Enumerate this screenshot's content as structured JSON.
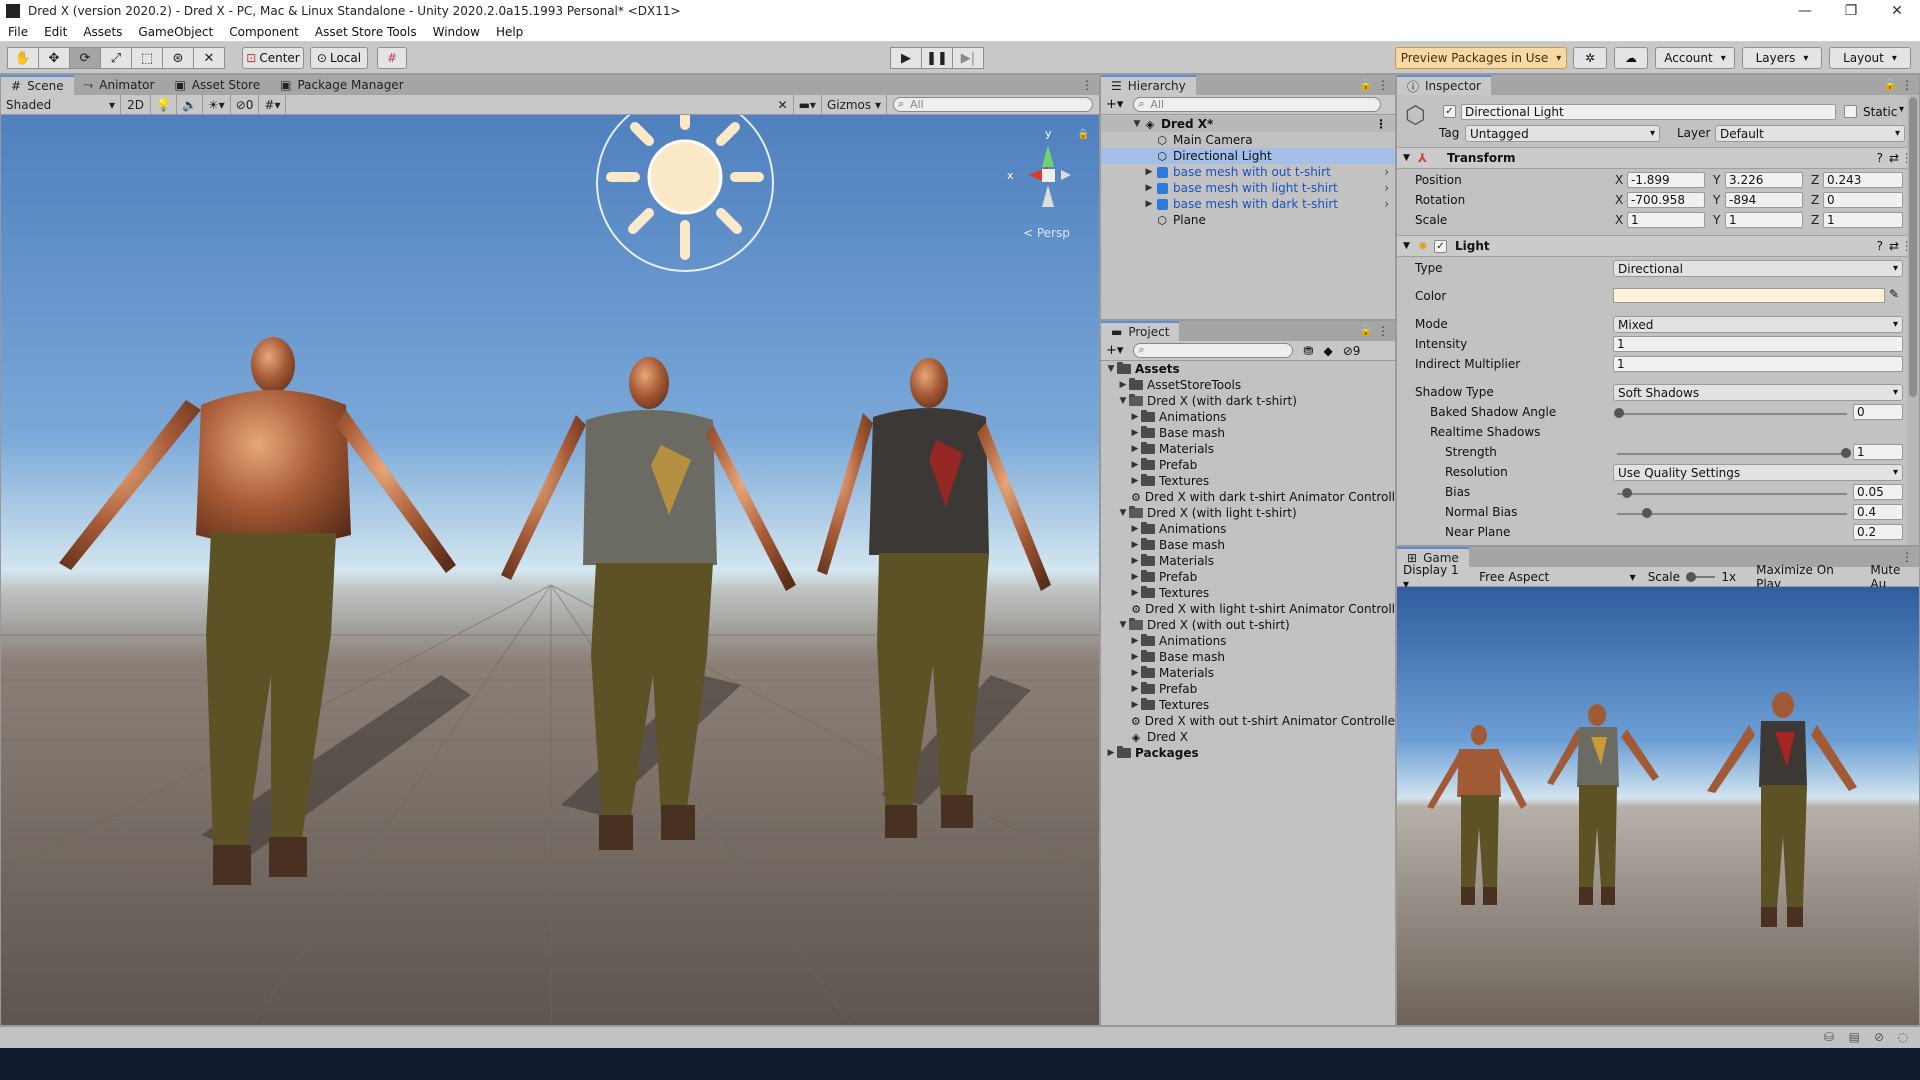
{
  "window": {
    "title": "Dred X (version 2020.2) - Dred X - PC, Mac & Linux Standalone - Unity 2020.2.0a15.1993 Personal* <DX11>",
    "minimize": "—",
    "maximize": "❐",
    "close": "✕"
  },
  "menubar": [
    "File",
    "Edit",
    "Assets",
    "GameObject",
    "Component",
    "Asset Store Tools",
    "Window",
    "Help"
  ],
  "toolbar": {
    "pivot": "Center",
    "space": "Local",
    "preview_packages": "Preview Packages in Use",
    "account": "Account",
    "layers": "Layers",
    "layout": "Layout"
  },
  "scene": {
    "tabs": [
      "Scene",
      "Animator",
      "Asset Store",
      "Package Manager"
    ],
    "shading": "Shaded",
    "mode_2d": "2D",
    "hidden_count": "0",
    "gizmos": "Gizmos",
    "search_placeholder": "All",
    "persp": "< Persp",
    "gizmo_y": "y",
    "gizmo_x": "x"
  },
  "hierarchy": {
    "tab": "Hierarchy",
    "search_placeholder": "All",
    "scene_name": "Dred X*",
    "items": [
      {
        "label": "Main Camera",
        "type": "object",
        "indent": 1
      },
      {
        "label": "Directional Light",
        "type": "object",
        "indent": 1,
        "selected": true
      },
      {
        "label": "base mesh with out t-shirt",
        "type": "prefab",
        "indent": 1
      },
      {
        "label": "base mesh with light t-shirt",
        "type": "prefab",
        "indent": 1
      },
      {
        "label": "base mesh with dark t-shirt",
        "type": "prefab",
        "indent": 1
      },
      {
        "label": "Plane",
        "type": "object",
        "indent": 1
      }
    ]
  },
  "project": {
    "tab": "Project",
    "hidden_count": "9",
    "tree": [
      {
        "label": "Assets",
        "level": 0,
        "bold": true,
        "expanded": true,
        "kind": "folder"
      },
      {
        "label": "AssetStoreTools",
        "level": 1,
        "kind": "folder"
      },
      {
        "label": "Dred X (with dark t-shirt)",
        "level": 1,
        "expanded": true,
        "kind": "folder-open"
      },
      {
        "label": "Animations",
        "level": 2,
        "kind": "folder"
      },
      {
        "label": "Base mash",
        "level": 2,
        "kind": "folder"
      },
      {
        "label": "Materials",
        "level": 2,
        "kind": "folder"
      },
      {
        "label": "Prefab",
        "level": 2,
        "kind": "folder"
      },
      {
        "label": "Textures",
        "level": 2,
        "kind": "folder"
      },
      {
        "label": "Dred X with dark t-shirt Animator Controll",
        "level": 2,
        "kind": "animator",
        "leaf": true
      },
      {
        "label": "Dred X (with light t-shirt)",
        "level": 1,
        "expanded": true,
        "kind": "folder-open"
      },
      {
        "label": "Animations",
        "level": 2,
        "kind": "folder"
      },
      {
        "label": "Base mash",
        "level": 2,
        "kind": "folder"
      },
      {
        "label": "Materials",
        "level": 2,
        "kind": "folder"
      },
      {
        "label": "Prefab",
        "level": 2,
        "kind": "folder"
      },
      {
        "label": "Textures",
        "level": 2,
        "kind": "folder"
      },
      {
        "label": "Dred X with light t-shirt Animator Controll",
        "level": 2,
        "kind": "animator",
        "leaf": true
      },
      {
        "label": "Dred X (with out t-shirt)",
        "level": 1,
        "expanded": true,
        "kind": "folder-open"
      },
      {
        "label": "Animations",
        "level": 2,
        "kind": "folder"
      },
      {
        "label": "Base mash",
        "level": 2,
        "kind": "folder"
      },
      {
        "label": "Materials",
        "level": 2,
        "kind": "folder"
      },
      {
        "label": "Prefab",
        "level": 2,
        "kind": "folder"
      },
      {
        "label": "Textures",
        "level": 2,
        "kind": "folder"
      },
      {
        "label": "Dred X with out t-shirt Animator Controlle",
        "level": 2,
        "kind": "animator",
        "leaf": true
      },
      {
        "label": "Dred X",
        "level": 1,
        "kind": "scene",
        "leaf": true
      },
      {
        "label": "Packages",
        "level": 0,
        "bold": true,
        "kind": "folder"
      }
    ]
  },
  "inspector": {
    "tab": "Inspector",
    "object_name": "Directional Light",
    "static_label": "Static",
    "tag_label": "Tag",
    "tag_value": "Untagged",
    "layer_label": "Layer",
    "layer_value": "Default",
    "transform": {
      "title": "Transform",
      "position_label": "Position",
      "rotation_label": "Rotation",
      "scale_label": "Scale",
      "position": {
        "x": "-1.899",
        "y": "3.226",
        "z": "0.243"
      },
      "rotation": {
        "x": "-700.958",
        "y": "-894",
        "z": "0"
      },
      "scale": {
        "x": "1",
        "y": "1",
        "z": "1"
      }
    },
    "light": {
      "title": "Light",
      "type_label": "Type",
      "type_value": "Directional",
      "color_label": "Color",
      "color_value": "#fdf1d8",
      "mode_label": "Mode",
      "mode_value": "Mixed",
      "intensity_label": "Intensity",
      "intensity_value": "1",
      "indirect_label": "Indirect Multiplier",
      "indirect_value": "1",
      "shadow_type_label": "Shadow Type",
      "shadow_type_value": "Soft Shadows",
      "baked_angle_label": "Baked Shadow Angle",
      "baked_angle_value": "0",
      "realtime_label": "Realtime Shadows",
      "strength_label": "Strength",
      "strength_value": "1",
      "resolution_label": "Resolution",
      "resolution_value": "Use Quality Settings",
      "bias_label": "Bias",
      "bias_value": "0.05",
      "normal_bias_label": "Normal Bias",
      "normal_bias_value": "0.4",
      "near_plane_label": "Near Plane",
      "near_plane_value": "0.2"
    }
  },
  "game": {
    "tab": "Game",
    "display": "Display 1",
    "aspect": "Free Aspect",
    "scale_label": "Scale",
    "scale_value": "1x",
    "maximize": "Maximize On Play",
    "mute": "Mute Au"
  },
  "colors": {
    "accent": "#5a8fd6",
    "selection": "#a3bfe8",
    "prefab_text": "#1555c0",
    "preview_bg": "#f6d9a6"
  }
}
